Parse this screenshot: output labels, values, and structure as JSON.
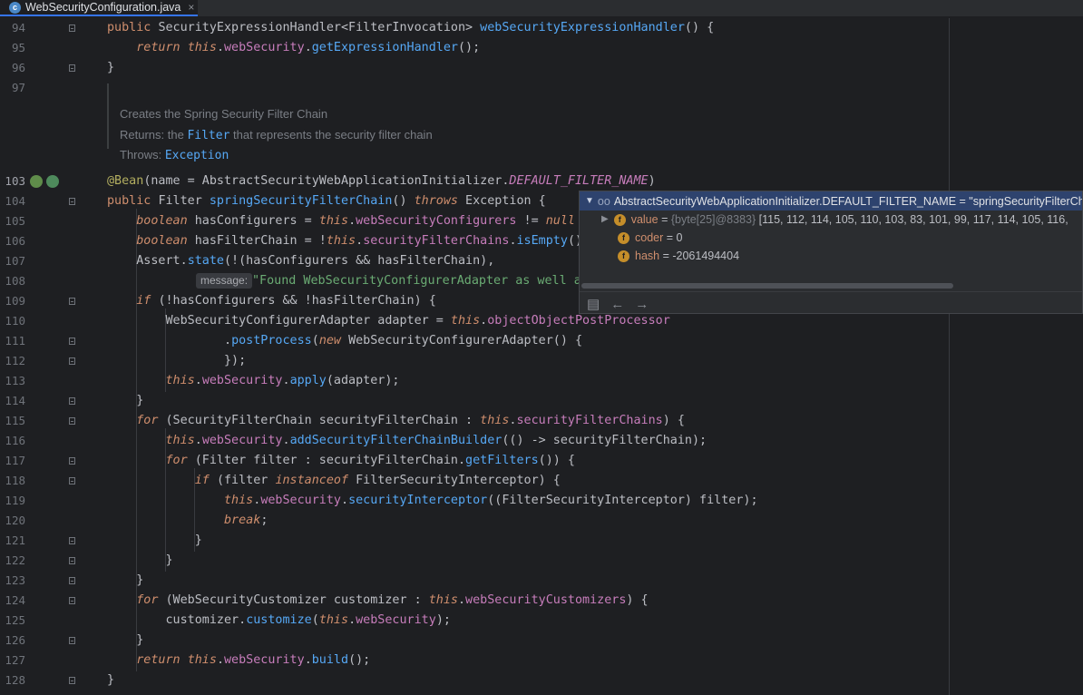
{
  "tab": {
    "filename": "WebSecurityConfiguration.java",
    "close": "×",
    "icon": "c"
  },
  "doc": {
    "line1": "Creates the Spring Security Filter Chain",
    "line2_prefix": "Returns: the ",
    "line2_link": "Filter",
    "line2_suffix": " that represents the security filter chain",
    "line3_prefix": "Throws: ",
    "line3_link": "Exception"
  },
  "hint": {
    "message_label": "message:"
  },
  "debug_popup": {
    "header": "AbstractSecurityWebApplicationInitializer.DEFAULT_FILTER_NAME = \"springSecurityFilterChain\"",
    "fields": [
      {
        "name": "value",
        "ref": "{byte[25]@8383}",
        "val": "[115, 112, 114, 105, 110, 103, 83, 101, 99, 117, 114, 105, 116,"
      },
      {
        "name": "coder",
        "val": "0"
      },
      {
        "name": "hash",
        "val": "-2061494404"
      }
    ]
  },
  "line_numbers": [
    "94",
    "95",
    "96",
    "97",
    "103",
    "104",
    "105",
    "106",
    "107",
    "108",
    "109",
    "110",
    "111",
    "112",
    "113",
    "114",
    "115",
    "116",
    "117",
    "118",
    "119",
    "120",
    "121",
    "122",
    "123",
    "124",
    "125",
    "126",
    "127",
    "128"
  ]
}
